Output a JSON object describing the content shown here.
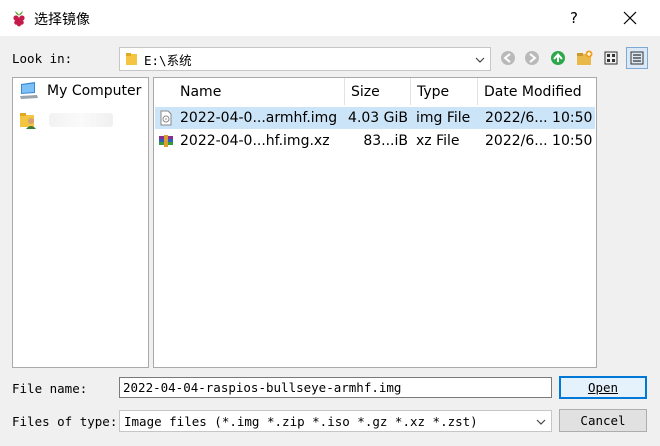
{
  "window": {
    "title": "选择镜像",
    "help_label": "?"
  },
  "lookin": {
    "label": "Look in:",
    "path": "E:\\系统"
  },
  "sidebar": {
    "items": [
      {
        "label": "My Computer"
      }
    ]
  },
  "filelist": {
    "columns": [
      "Name",
      "Size",
      "Type",
      "Date Modified"
    ],
    "rows": [
      {
        "name": "2022-04-0...armhf.img",
        "size": "4.03 GiB",
        "type": "img File",
        "date": "2022/6... 10:50",
        "selected": true
      },
      {
        "name": "2022-04-0...hf.img.xz",
        "size": "83...iB",
        "type": "xz File",
        "date": "2022/6... 10:50",
        "selected": false
      }
    ]
  },
  "bottom": {
    "filename_label": "File name:",
    "filename_value": "2022-04-04-raspios-bullseye-armhf.img",
    "filetype_label": "Files of type:",
    "filetype_value": "Image files (*.img *.zip *.iso *.gz *.xz *.zst)",
    "open_label": "Open",
    "cancel_label": "Cancel"
  },
  "icons": {
    "app": "raspberry-icon",
    "close": "close-icon",
    "folder": "folder-icon",
    "back": "back-arrow-icon",
    "forward": "forward-arrow-icon",
    "up": "up-arrow-icon",
    "new_folder": "new-folder-icon",
    "list_view": "list-view-icon",
    "detail_view": "detail-view-icon"
  },
  "colors": {
    "selection": "#cce4f7",
    "accent": "#0078d7"
  }
}
